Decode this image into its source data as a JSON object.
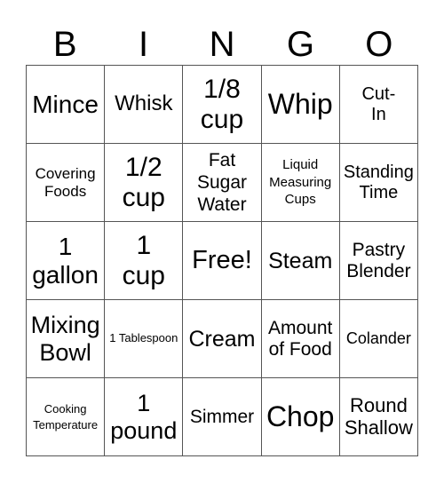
{
  "header": [
    "B",
    "I",
    "N",
    "G",
    "O"
  ],
  "cells": [
    "Mince",
    "Whisk",
    "1/8 cup",
    "Whip",
    "Cut-In",
    "Covering Foods",
    "1/2 cup",
    "Fat Sugar Water",
    "Liquid Measuring Cups",
    "Standing Time",
    "1 gallon",
    "1 cup",
    "Free!",
    "Steam",
    "Pastry Blender",
    "Mixing Bowl",
    "1 Tablespoon",
    "Cream",
    "Amount of Food",
    "Colander",
    "Cooking Temperature",
    "1 pound",
    "Simmer",
    "Chop",
    "Round Shallow"
  ]
}
